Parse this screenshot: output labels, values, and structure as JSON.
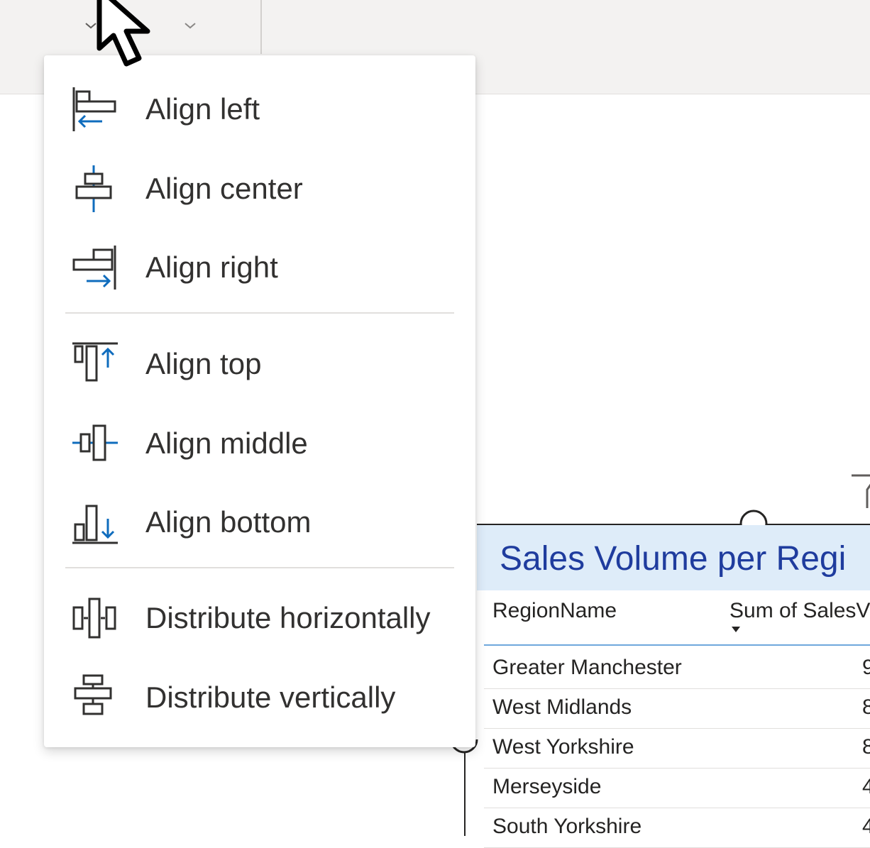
{
  "menu": {
    "items": [
      {
        "label": "Align left",
        "icon": "align-left-icon"
      },
      {
        "label": "Align center",
        "icon": "align-center-icon"
      },
      {
        "label": "Align right",
        "icon": "align-right-icon"
      },
      {
        "label": "Align top",
        "icon": "align-top-icon"
      },
      {
        "label": "Align middle",
        "icon": "align-middle-icon"
      },
      {
        "label": "Align bottom",
        "icon": "align-bottom-icon"
      },
      {
        "label": "Distribute horizontally",
        "icon": "distribute-horizontally-icon"
      },
      {
        "label": "Distribute vertically",
        "icon": "distribute-vertically-icon"
      }
    ]
  },
  "visual": {
    "title": "Sales Volume per Regi",
    "columns": [
      "RegionName",
      "Sum of SalesV"
    ],
    "rows": [
      {
        "name": "Greater Manchester",
        "value": "9"
      },
      {
        "name": "West Midlands",
        "value": "8"
      },
      {
        "name": "West Yorkshire",
        "value": "8"
      },
      {
        "name": "Merseyside",
        "value": "4"
      },
      {
        "name": "South Yorkshire",
        "value": "4"
      }
    ]
  },
  "colors": {
    "accent_blue": "#0f6cbd",
    "title_blue": "#1f3c9e",
    "title_band": "#deecf9"
  }
}
